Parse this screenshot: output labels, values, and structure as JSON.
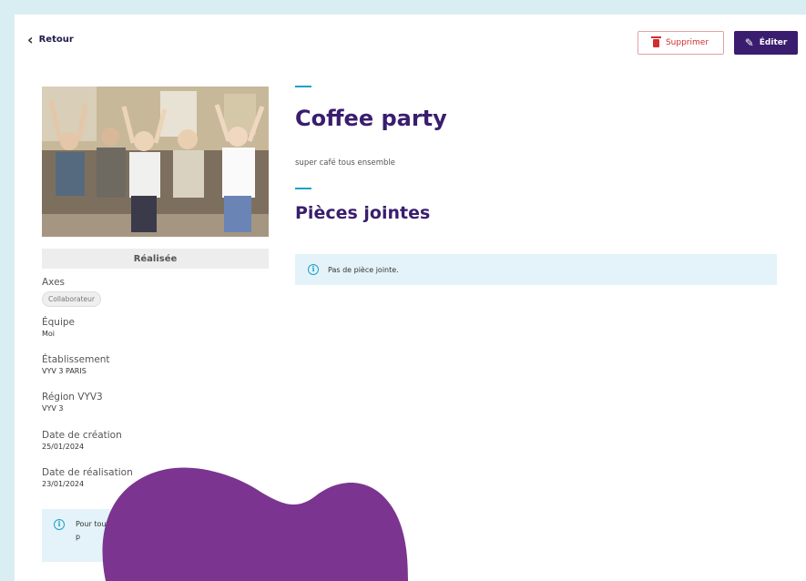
{
  "header": {
    "back_label": "Retour",
    "delete_label": "Supprimer",
    "edit_label": "Éditer"
  },
  "icons": {
    "back": "chevron-left-icon",
    "delete": "trash-icon",
    "edit": "pencil-icon",
    "info": "info-icon"
  },
  "colors": {
    "accent": "#3a1d6e",
    "danger": "#d12e2e",
    "info_bg": "#e3f3f9",
    "info_icon": "#20a0c8",
    "overlay": "#7b3590"
  },
  "sidebar": {
    "status": "Réalisée",
    "axes": {
      "label": "Axes",
      "chip": "Collaborateur"
    },
    "equipe": {
      "label": "Équipe",
      "value": "Moi"
    },
    "etablissement": {
      "label": "Établissement",
      "value": "VYV 3 PARIS"
    },
    "region": {
      "label": "Région VYV3",
      "value": "VYV 3"
    },
    "creation": {
      "label": "Date de création",
      "value": "25/01/2024"
    },
    "realisation": {
      "label": "Date de réalisation",
      "value": "23/01/2024"
    },
    "info_text": "Pour tout rapproc pour p"
  },
  "main": {
    "title": "Coffee party",
    "description": "super café tous ensemble",
    "attachments_title": "Pièces jointes",
    "attachments_empty": "Pas de pièce jointe."
  }
}
